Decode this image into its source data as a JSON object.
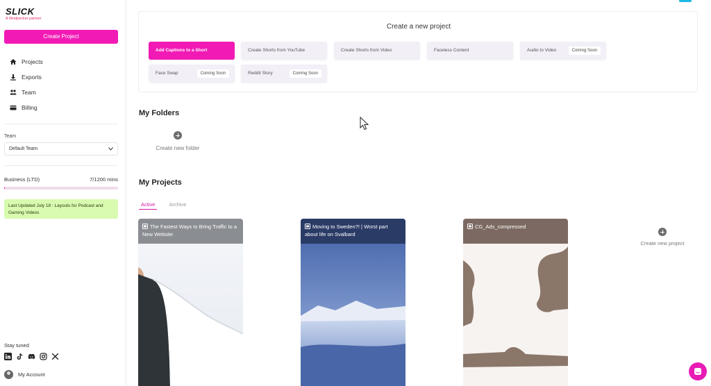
{
  "brand": {
    "logo": "SLICK",
    "subtitle": "A Wudpecker partner"
  },
  "sidebar": {
    "create_label": "Create Project",
    "nav": [
      {
        "label": "Projects",
        "icon": "home-icon"
      },
      {
        "label": "Exports",
        "icon": "download-icon"
      },
      {
        "label": "Team",
        "icon": "team-icon"
      },
      {
        "label": "Billing",
        "icon": "card-icon"
      }
    ],
    "team_label": "Team",
    "team_value": "Default Team",
    "plan_name": "Business (LTD)",
    "plan_usage": "7/1200 mins",
    "plan_usage_fraction": 0.006,
    "update_text": "Last Updated July 18 : Layouts for Podcast and Gaming Videos",
    "stay_tuned": "Stay tuned",
    "socials": [
      "linkedin-icon",
      "tiktok-icon",
      "discord-icon",
      "instagram-icon",
      "x-icon"
    ],
    "account_label": "My Account"
  },
  "create_panel": {
    "title": "Create a new project",
    "options": [
      {
        "label": "Add Captions to a Short",
        "badge": ""
      },
      {
        "label": "Create Shorts from YouTube",
        "badge": ""
      },
      {
        "label": "Create Shorts from Video",
        "badge": ""
      },
      {
        "label": "Faceless Content",
        "badge": ""
      },
      {
        "label": "Audio to Video",
        "badge": "Coming Soon"
      },
      {
        "label": "Face Swap",
        "badge": "Coming Soon"
      },
      {
        "label": "Reddit Story",
        "badge": "Coming Soon"
      }
    ]
  },
  "folders": {
    "title": "My Folders",
    "new_label": "Create new folder"
  },
  "projects": {
    "title": "My Projects",
    "tabs": [
      "Active",
      "Archive"
    ],
    "cards": [
      {
        "title": "The Fastest Ways to Bring Traffic to a New Website"
      },
      {
        "title": "Moving to Sweden?! | Worst part about life on Svalbard"
      },
      {
        "title": "CG_Ads_compressed"
      }
    ],
    "new_label": "Create new project"
  },
  "colors": {
    "accent": "#f21ab5",
    "update_bg": "#d8fbb0",
    "top_accent": "#1fb8e0"
  }
}
